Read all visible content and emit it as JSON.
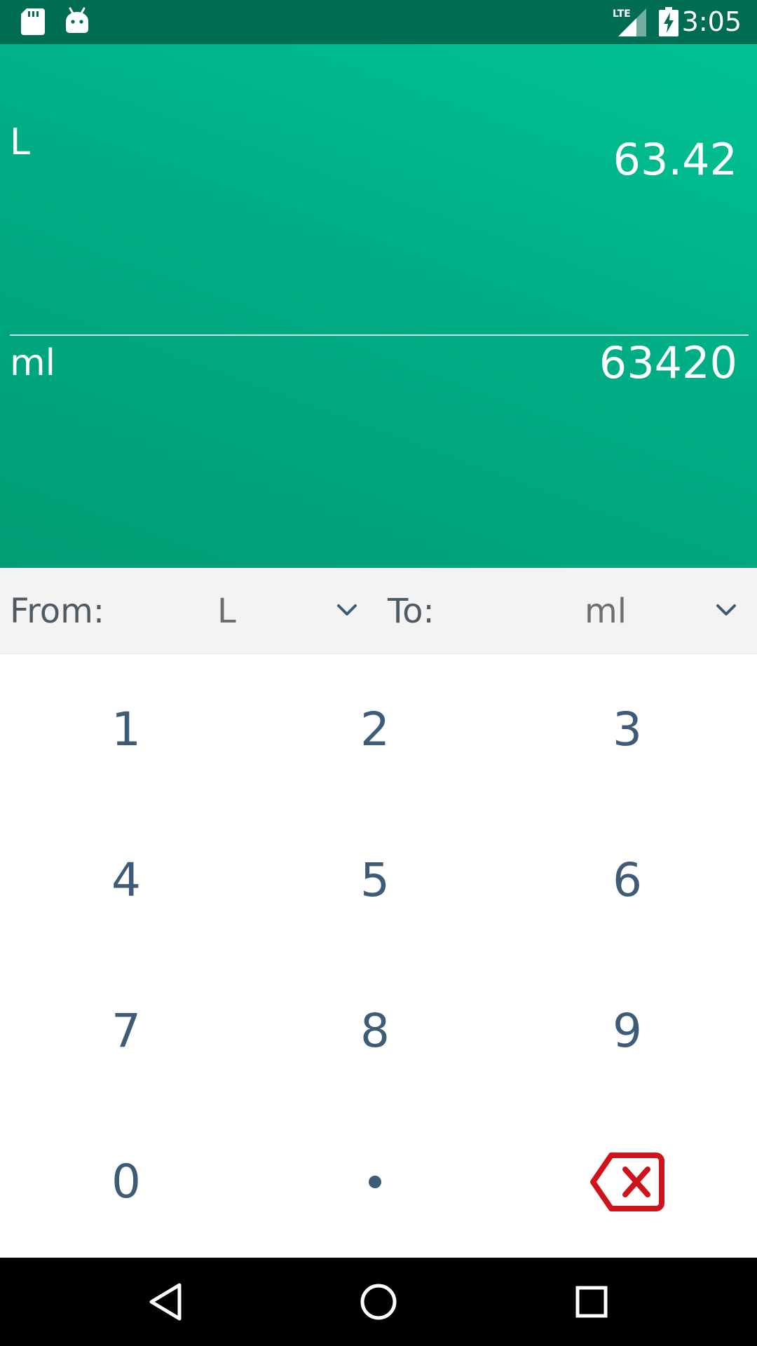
{
  "status_bar": {
    "time": "3:05",
    "network": "LTE",
    "icons": [
      "sd-card-icon",
      "android-icon",
      "lte-signal-icon",
      "battery-charging-icon"
    ]
  },
  "display": {
    "from_unit": "L",
    "from_value": "63.42",
    "to_unit": "ml",
    "to_value": "63420"
  },
  "selectors": {
    "from_label": "From:",
    "from_value": "L",
    "to_label": "To:",
    "to_value": "ml"
  },
  "keypad": {
    "keys": [
      "1",
      "2",
      "3",
      "4",
      "5",
      "6",
      "7",
      "8",
      "9",
      "0",
      "•"
    ],
    "backspace_icon": "backspace-icon"
  },
  "nav_bar": {
    "buttons": [
      "back-icon",
      "home-icon",
      "recents-icon"
    ]
  },
  "colors": {
    "status_bar": "#006d52",
    "display_gradient_start": "#00c394",
    "display_gradient_end": "#009d74",
    "key_text": "#3e5c78",
    "backspace": "#d0121b",
    "selector_bg": "#f3f3f3"
  }
}
